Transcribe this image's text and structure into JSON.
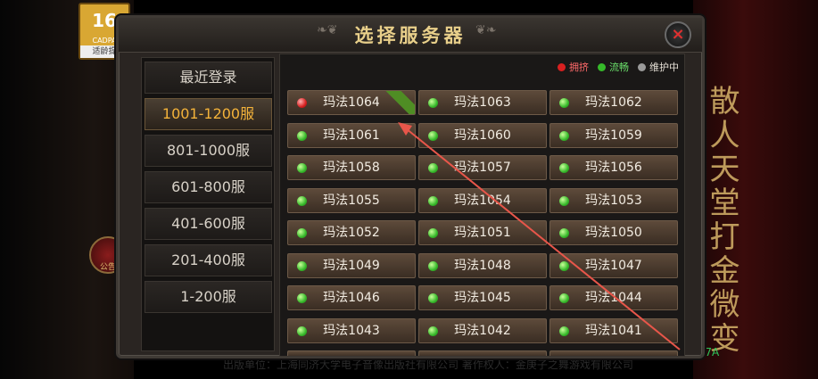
{
  "age_badge": {
    "age": "16",
    "sub": "CADPA",
    "label": "适龄提"
  },
  "dialog": {
    "title": "选择服务器",
    "close": "×"
  },
  "legend": [
    {
      "label": "拥挤",
      "color": "#d82020"
    },
    {
      "label": "流畅",
      "color": "#36b92a"
    },
    {
      "label": "维护中",
      "color": "#9a9a9a"
    }
  ],
  "categories": [
    "最近登录",
    "1001-1200服",
    "801-1000服",
    "601-800服",
    "401-600服",
    "201-400服",
    "1-200服"
  ],
  "active_category": "1001-1200服",
  "servers": [
    {
      "name": "玛法1064",
      "status": "crowded",
      "tag": ""
    },
    {
      "name": "玛法1063",
      "status": "smooth"
    },
    {
      "name": "玛法1062",
      "status": "smooth"
    },
    {
      "name": "玛法1061",
      "status": "smooth"
    },
    {
      "name": "玛法1060",
      "status": "smooth"
    },
    {
      "name": "玛法1059",
      "status": "smooth"
    },
    {
      "name": "玛法1058",
      "status": "smooth"
    },
    {
      "name": "玛法1057",
      "status": "smooth"
    },
    {
      "name": "玛法1056",
      "status": "smooth"
    },
    {
      "name": "玛法1055",
      "status": "smooth"
    },
    {
      "name": "玛法1054",
      "status": "smooth"
    },
    {
      "name": "玛法1053",
      "status": "smooth"
    },
    {
      "name": "玛法1052",
      "status": "smooth"
    },
    {
      "name": "玛法1051",
      "status": "smooth"
    },
    {
      "name": "玛法1050",
      "status": "smooth"
    },
    {
      "name": "玛法1049",
      "status": "smooth"
    },
    {
      "name": "玛法1048",
      "status": "smooth"
    },
    {
      "name": "玛法1047",
      "status": "smooth"
    },
    {
      "name": "玛法1046",
      "status": "smooth"
    },
    {
      "name": "玛法1045",
      "status": "smooth"
    },
    {
      "name": "玛法1044",
      "status": "smooth"
    },
    {
      "name": "玛法1043",
      "status": "smooth"
    },
    {
      "name": "玛法1042",
      "status": "smooth"
    },
    {
      "name": "玛法1041",
      "status": "smooth"
    }
  ],
  "side_text": "散人天堂打金微变",
  "side_ornament_label": "公告",
  "side_link": "-7A",
  "footer": "出版单位：上海同济大学电子音像出版社有限公司  著作权人：金庚子之舞游戏有限公司",
  "colors": {
    "accent": "#f3b23a",
    "title": "#e8cf8a",
    "arrow": "#e8564a"
  },
  "icons": {
    "crowded": "red-status-dot-icon",
    "smooth": "green-status-dot-icon",
    "maintenance": "gray-status-dot-icon"
  }
}
